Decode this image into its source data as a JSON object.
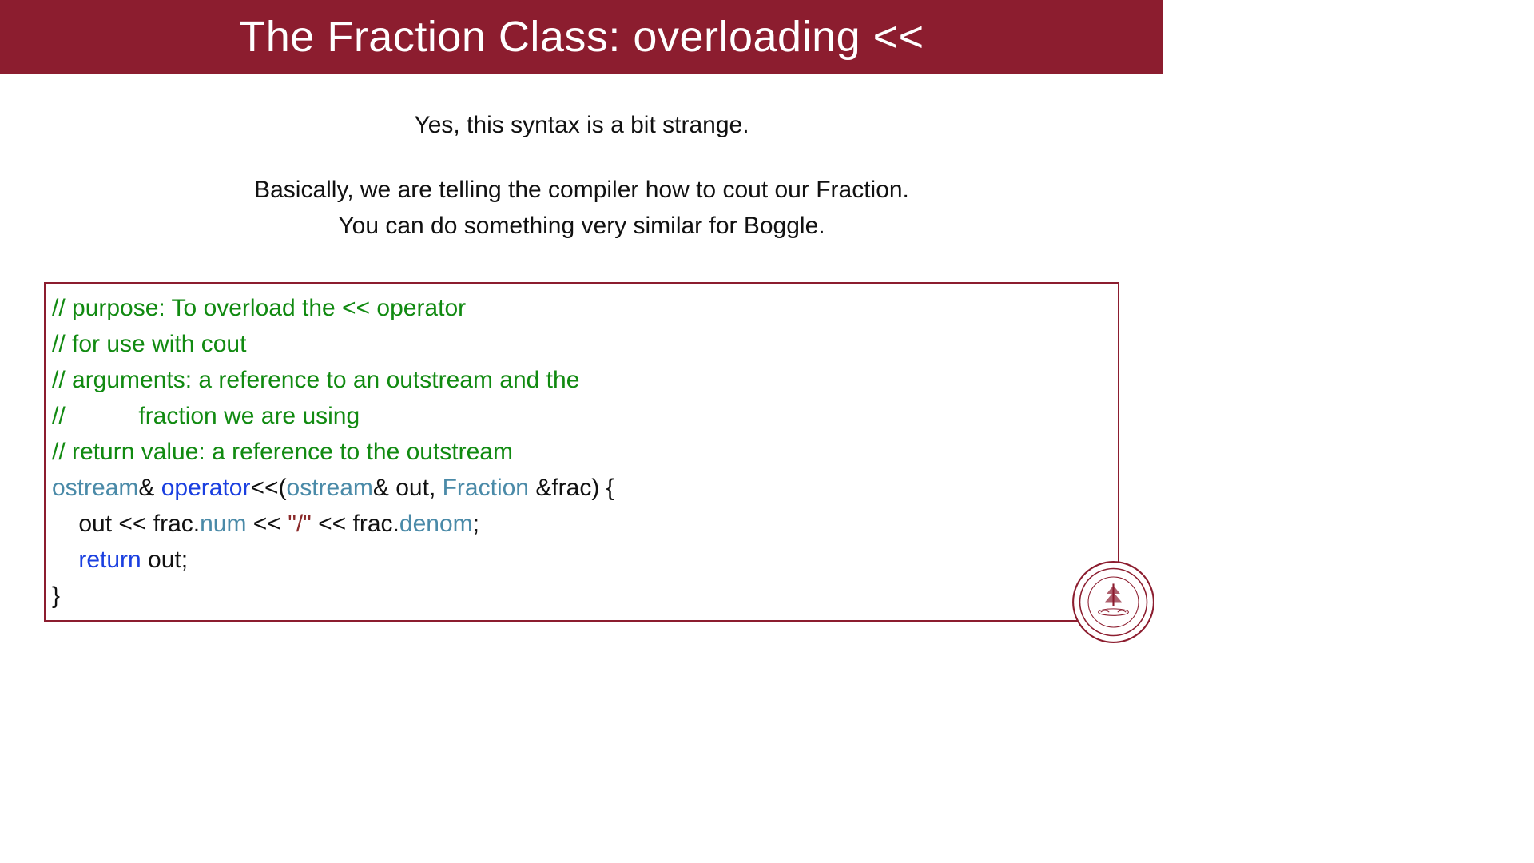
{
  "header": {
    "title": "The Fraction Class: overloading <<"
  },
  "intro": {
    "p1": "Yes, this syntax is a bit strange.",
    "p2a": "Basically, we are telling the compiler how to cout our Fraction.",
    "p2b": "You can do something very similar for Boggle."
  },
  "code": {
    "c1": "// purpose: To overload the << operator",
    "c2": "// for use with cout",
    "c3": "// arguments: a reference to an outstream and the",
    "c4": "//           fraction we are using",
    "c5": "// return value: a reference to the outstream",
    "t_ostream": "ostream",
    "amp": "& ",
    "t_operator": "operator",
    "sig_tail": "<<(",
    "amp2": "& out, ",
    "t_fraction": "Fraction",
    "sig_end": " &frac) {",
    "l_indent": "    ",
    "l_out1": "out << frac.",
    "m_num": "num",
    "l_mid": " << ",
    "s_slash": "\"/\"",
    "l_mid2": " << frac.",
    "m_denom": "denom",
    "l_semi": ";",
    "k_return": "return",
    "l_ret_tail": " out;",
    "l_close": "}"
  },
  "seal_label": "stanford-seal"
}
